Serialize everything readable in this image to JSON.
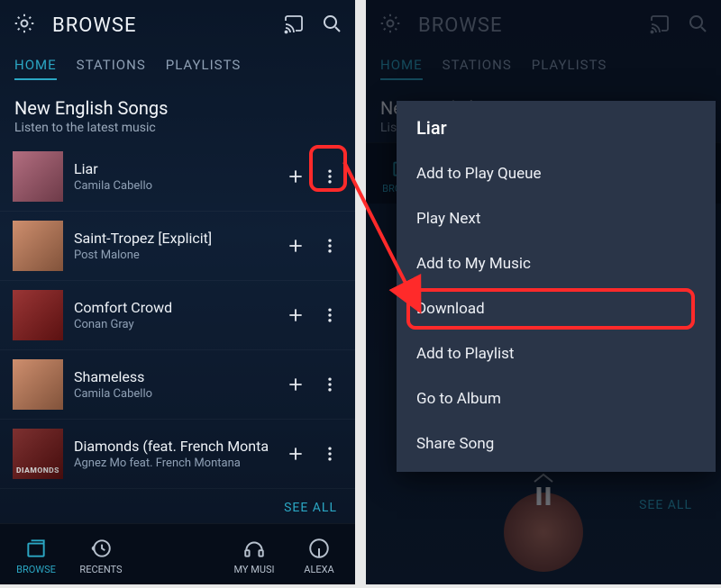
{
  "app_title": "BROWSE",
  "tabs": {
    "home": "HOME",
    "stations": "STATIONS",
    "playlists": "PLAYLISTS"
  },
  "section": {
    "title": "New English Songs",
    "subtitle": "Listen to the latest music"
  },
  "songs": [
    {
      "title": "Liar",
      "artist": "Camila Cabello",
      "art": "pink",
      "badge": ""
    },
    {
      "title": "Saint-Tropez [Explicit]",
      "artist": "Post Malone",
      "art": "peach",
      "badge": ""
    },
    {
      "title": "Comfort Crowd",
      "artist": "Conan Gray",
      "art": "red",
      "badge": ""
    },
    {
      "title": "Shameless",
      "artist": "Camila Cabello",
      "art": "peach",
      "badge": ""
    },
    {
      "title": "Diamonds (feat. French Monta",
      "artist": "Agnez Mo feat. French Montana",
      "art": "darkrd",
      "badge": "DIAMONDS"
    }
  ],
  "see_all": "SEE ALL",
  "bottom_nav": {
    "browse": "BROWSE",
    "recents": "RECENTS",
    "mymusic": "MY MUSIC",
    "alexa": "ALEXA"
  },
  "context_menu": {
    "title": "Liar",
    "items": [
      "Add to Play Queue",
      "Play Next",
      "Add to My Music",
      "Download",
      "Add to Playlist",
      "Go to Album",
      "Share Song"
    ]
  },
  "bottom_nav_trunc": {
    "browse": "BROWSE",
    "recents": "RECENTS",
    "mymusic": "MY MUSI",
    "alexa": "ALEXA"
  },
  "colors": {
    "accent": "#2ba7c4",
    "callout": "#ff2a2a",
    "menu_bg": "#2a3548"
  }
}
